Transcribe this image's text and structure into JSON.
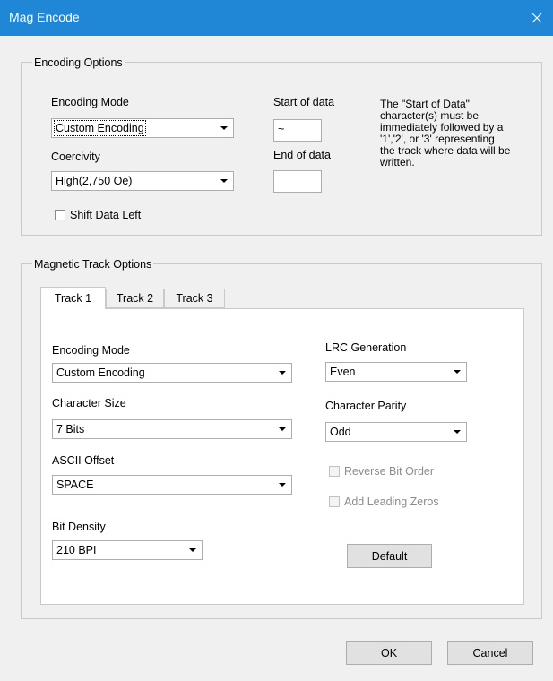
{
  "window": {
    "title": "Mag Encode",
    "close_icon": "close-icon"
  },
  "encoding_options": {
    "legend": "Encoding Options",
    "encoding_mode_label": "Encoding Mode",
    "encoding_mode_value": "Custom Encoding",
    "coercivity_label": "Coercivity",
    "coercivity_value": "High(2,750 Oe)",
    "start_of_data_label": "Start of data",
    "start_of_data_value": "~",
    "end_of_data_label": "End of data",
    "end_of_data_value": "",
    "note": "The \"Start of Data\"\ncharacter(s) must be\nimmediately followed by a\n'1','2', or '3' representing\nthe track where data will be\nwritten.",
    "shift_data_left_label": "Shift Data Left",
    "shift_data_left_checked": false
  },
  "track_options": {
    "legend": "Magnetic Track Options",
    "tabs": [
      {
        "label": "Track 1",
        "active": true
      },
      {
        "label": "Track 2",
        "active": false
      },
      {
        "label": "Track 3",
        "active": false
      }
    ],
    "encoding_mode_label": "Encoding Mode",
    "encoding_mode_value": "Custom Encoding",
    "character_size_label": "Character Size",
    "character_size_value": "7 Bits",
    "ascii_offset_label": "ASCII Offset",
    "ascii_offset_value": "SPACE",
    "bit_density_label": "Bit Density",
    "bit_density_value": "210 BPI",
    "lrc_generation_label": "LRC Generation",
    "lrc_generation_value": "Even",
    "character_parity_label": "Character Parity",
    "character_parity_value": "Odd",
    "reverse_bit_order_label": "Reverse Bit Order",
    "add_leading_zeros_label": "Add Leading Zeros",
    "default_button": "Default"
  },
  "footer": {
    "ok_button": "OK",
    "cancel_button": "Cancel"
  },
  "colors": {
    "titlebar": "#1f87d6",
    "dialog_bg": "#f0f0f0",
    "disabled_text": "#8c8c8c"
  }
}
